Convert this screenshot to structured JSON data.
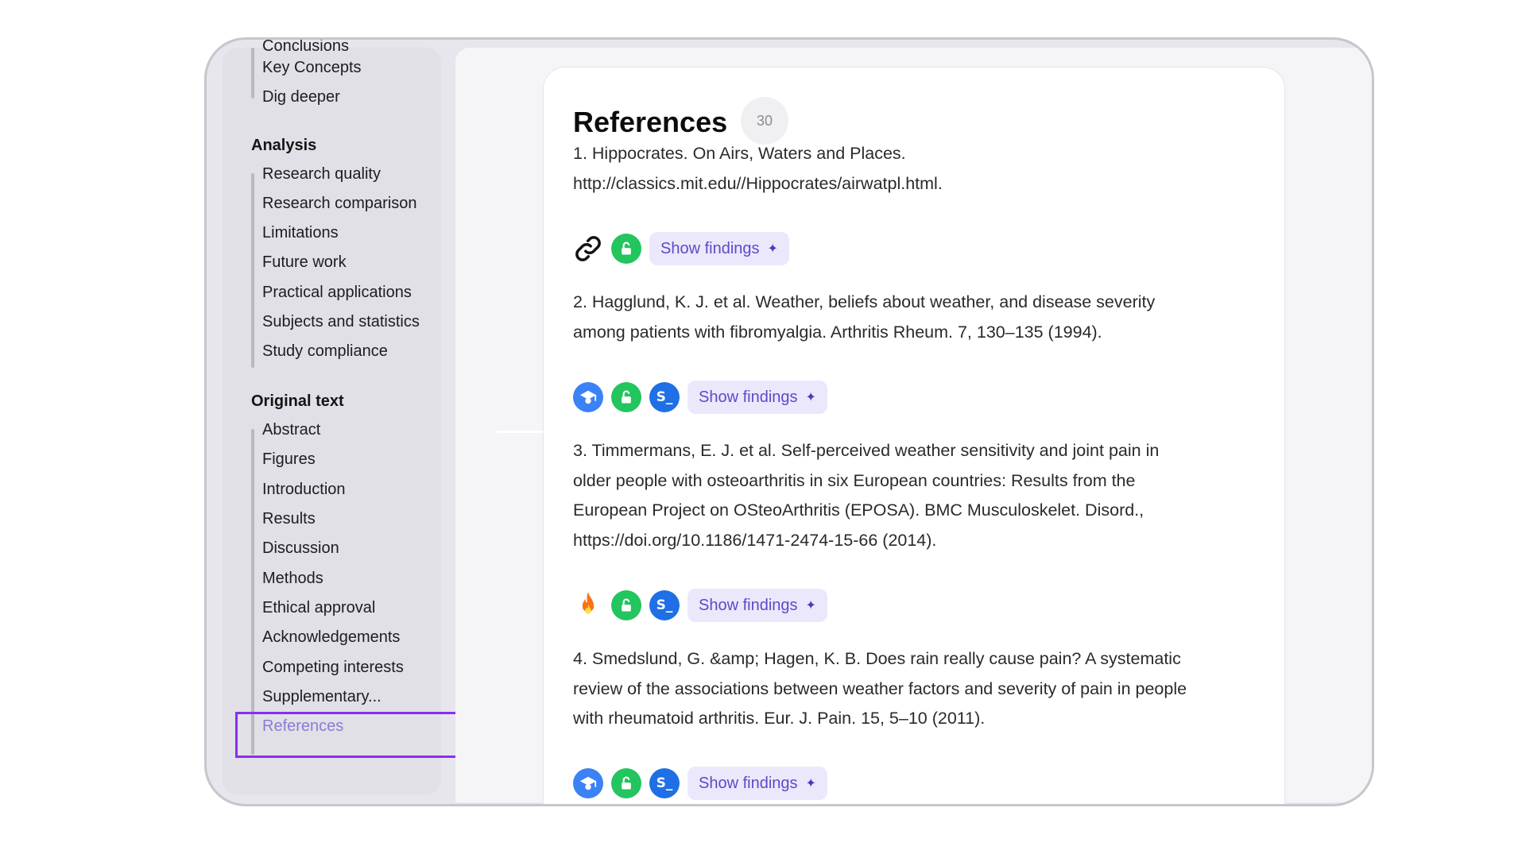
{
  "sidebar": {
    "cut_item": "Conclusions",
    "top_items": [
      "Key Concepts",
      "Dig deeper"
    ],
    "analysis": {
      "heading": "Analysis",
      "items": [
        "Research quality",
        "Research comparison",
        "Limitations",
        "Future work",
        "Practical applications",
        "Subjects and statistics",
        "Study compliance"
      ]
    },
    "original_text": {
      "heading": "Original text",
      "items": [
        "Abstract",
        "Figures",
        "Introduction",
        "Results",
        "Discussion",
        "Methods",
        "Ethical approval",
        "Acknowledgements",
        "Competing interests",
        "Supplementary...",
        "References"
      ]
    },
    "active_item": "References"
  },
  "main": {
    "title": "References",
    "count": "30",
    "show_findings_label": "Show findings",
    "references": [
      {
        "lines": [
          "1. Hippocrates. On Airs, Waters and Places.",
          "http://classics.mit.edu//Hippocrates/airwatpl.html."
        ],
        "icons": [
          "link-icon",
          "open-access-icon"
        ]
      },
      {
        "lines": [
          "2. Hagglund, K. J. et al. Weather, beliefs about weather, and disease severity",
          "among patients with fibromyalgia. Arthritis Rheum. 7, 130–135 (1994)."
        ],
        "icons": [
          "scholar-icon",
          "open-access-icon",
          "semantic-scholar-icon"
        ]
      },
      {
        "lines": [
          "3. Timmermans, E. J. et al. Self-perceived weather sensitivity and joint pain in",
          "older people with osteoarthritis in six European countries: Results from the",
          "European Project on OSteoArthritis (EPOSA). BMC Musculoskelet. Disord.,",
          "https://doi.org/10.1186/1471-2474-15-66 (2014)."
        ],
        "icons": [
          "fire-icon",
          "open-access-icon",
          "semantic-scholar-icon"
        ]
      },
      {
        "lines": [
          "4. Smedslund, G. &amp; Hagen, K. B. Does rain really cause pain? A systematic",
          "review of the associations between weather factors and severity of pain in people",
          "with rheumatoid arthritis. Eur. J. Pain. 15, 5–10 (2011)."
        ],
        "icons": [
          "scholar-icon",
          "open-access-icon",
          "semantic-scholar-icon"
        ]
      }
    ]
  },
  "colors": {
    "accent": "#8a2ef0",
    "active_nav": "#8a7cd8",
    "open_access_green": "#22c55e",
    "scholar_blue": "#3b82f6",
    "button_bg": "#ece8fb",
    "button_text": "#5c4ac9"
  }
}
